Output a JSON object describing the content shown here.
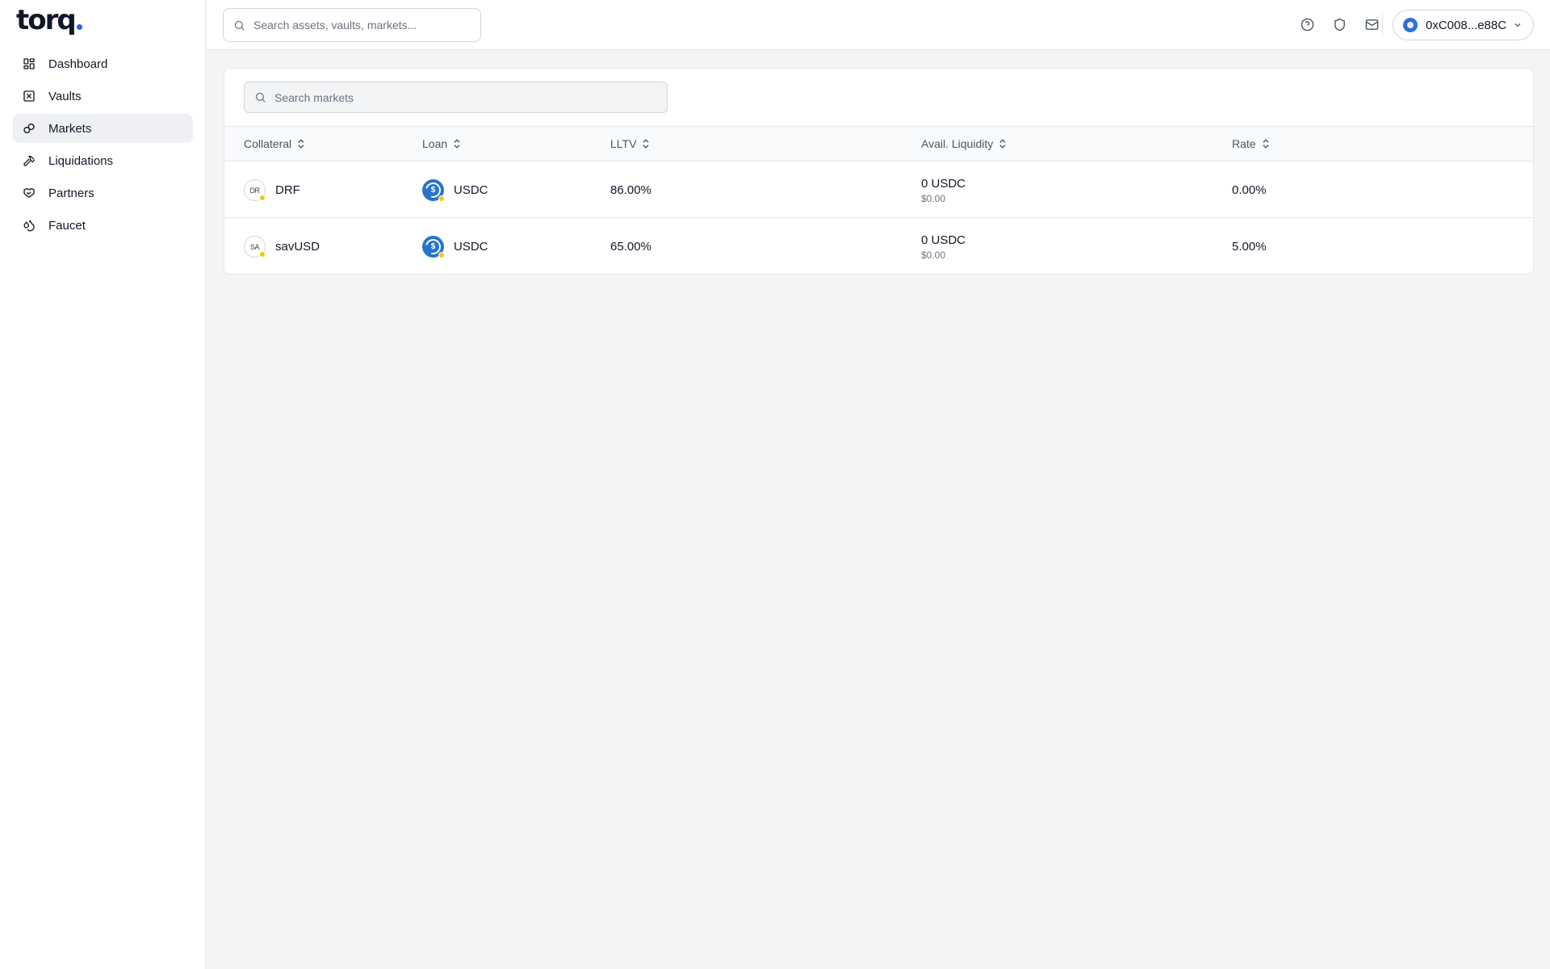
{
  "brand": {
    "logo_text": "torq",
    "accent": "#2563eb"
  },
  "sidebar": {
    "items": [
      {
        "label": "Dashboard",
        "icon": "grid-icon",
        "active": false
      },
      {
        "label": "Vaults",
        "icon": "vault-icon",
        "active": false
      },
      {
        "label": "Markets",
        "icon": "link-icon",
        "active": true
      },
      {
        "label": "Liquidations",
        "icon": "hammer-icon",
        "active": false
      },
      {
        "label": "Partners",
        "icon": "handshake-icon",
        "active": false
      },
      {
        "label": "Faucet",
        "icon": "droplets-icon",
        "active": false
      }
    ]
  },
  "topbar": {
    "search": {
      "placeholder": "Search assets, vaults, markets...",
      "value": ""
    },
    "icons": [
      "help-circle-icon",
      "shield-icon",
      "mail-icon"
    ],
    "wallet": {
      "address": "0xC008...e88C"
    }
  },
  "markets": {
    "search": {
      "placeholder": "Search markets",
      "value": ""
    },
    "columns": [
      "Collateral",
      "Loan",
      "LLTV",
      "Avail. Liquidity",
      "Rate"
    ],
    "rows": [
      {
        "collateral": {
          "symbol": "DRF",
          "icon_text": "DR"
        },
        "loan": {
          "symbol": "USDC"
        },
        "lltv": "86.00%",
        "liquidity": {
          "amount": "0 USDC",
          "usd": "$0.00"
        },
        "rate": "0.00%"
      },
      {
        "collateral": {
          "symbol": "savUSD",
          "icon_text": "SA"
        },
        "loan": {
          "symbol": "USDC"
        },
        "lltv": "65.00%",
        "liquidity": {
          "amount": "0 USDC",
          "usd": "$0.00"
        },
        "rate": "5.00%"
      }
    ]
  }
}
